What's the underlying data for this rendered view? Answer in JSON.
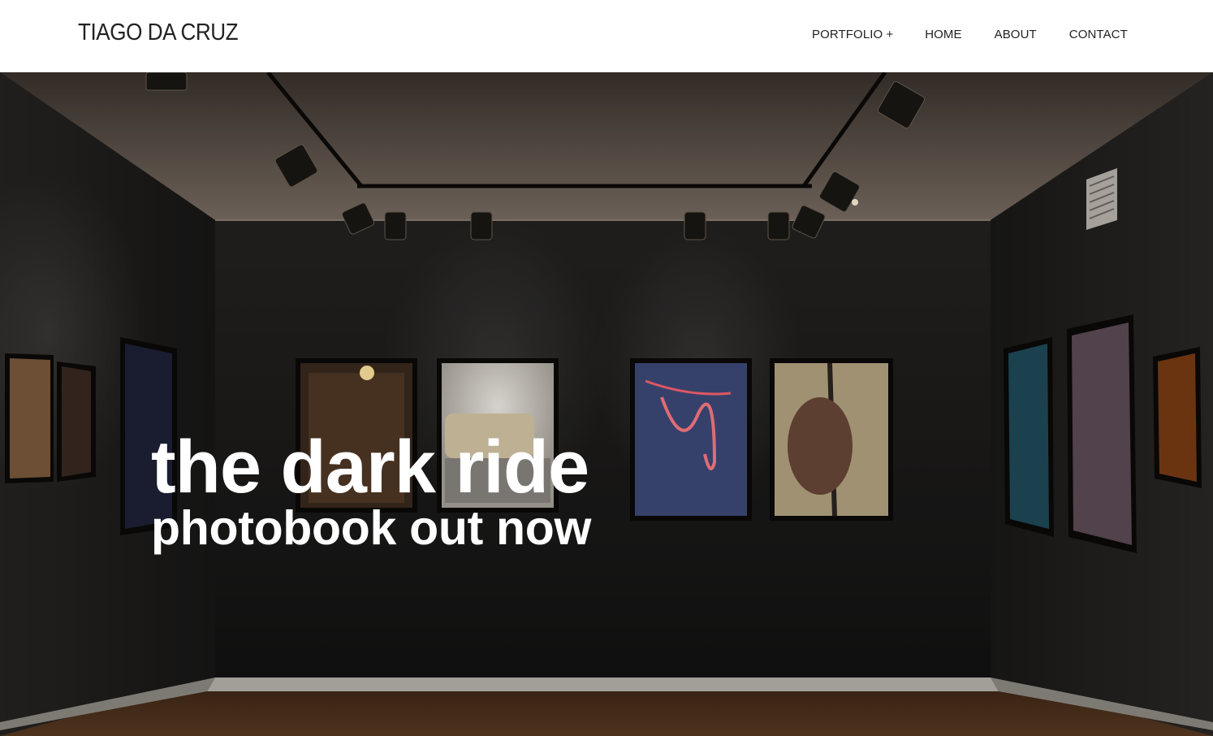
{
  "header": {
    "logo": "TIAGO DA CRUZ",
    "nav": {
      "portfolio": "PORTFOLIO",
      "portfolio_toggle": "+",
      "home": "HOME",
      "about": "ABOUT",
      "contact": "CONTACT"
    }
  },
  "hero": {
    "title": "the dark ride",
    "subtitle": "photobook out now"
  }
}
